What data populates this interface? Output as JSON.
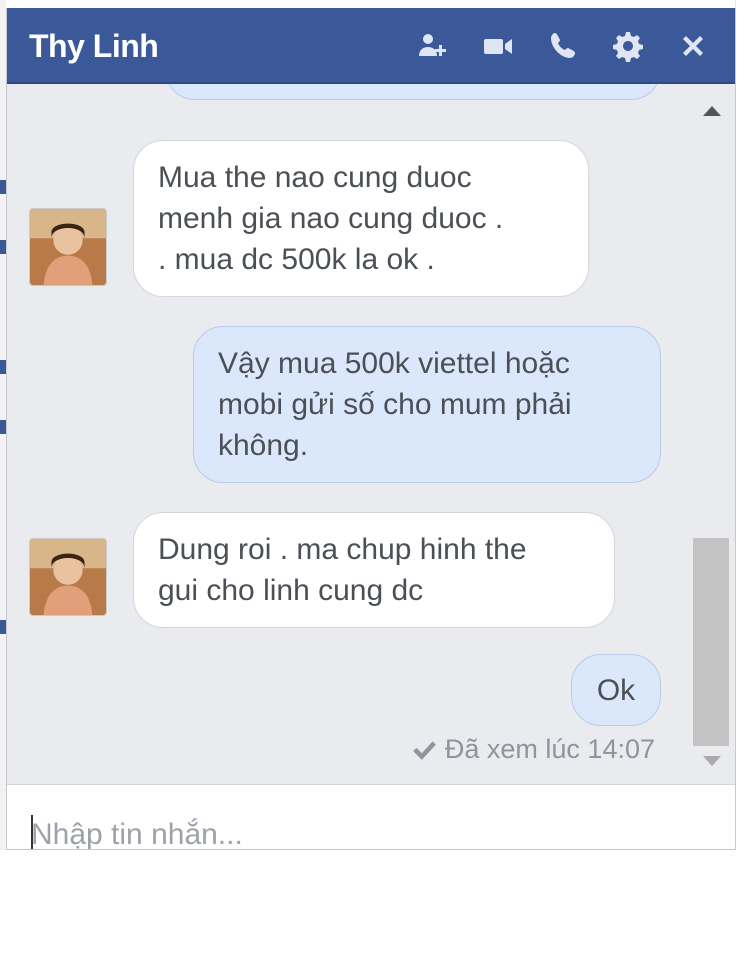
{
  "header": {
    "title": "Thy Linh",
    "icons": [
      "add-people-icon",
      "video-call-icon",
      "phone-icon",
      "gear-icon",
      "close-icon"
    ]
  },
  "messages": [
    {
      "direction": "incoming",
      "lines": [
        "Mua the nao cung duoc",
        "menh gia nao cung duoc .",
        ". mua dc 500k la ok ."
      ]
    },
    {
      "direction": "outgoing",
      "lines": [
        "Vậy mua 500k viettel hoặc",
        "mobi gửi số cho mum phải",
        "không."
      ]
    },
    {
      "direction": "incoming",
      "lines": [
        "Dung roi . ma chup hinh the",
        "gui cho linh cung dc"
      ]
    },
    {
      "direction": "outgoing",
      "lines": [
        "Ok"
      ]
    }
  ],
  "seen_status": "Đã xem lúc  14:07",
  "composer": {
    "placeholder": "Nhập tin nhắn..."
  },
  "colors": {
    "header": "#3b5998",
    "outgoing_bubble": "#dbe8fb",
    "incoming_bubble": "#ffffff",
    "background": "#e9ebee"
  }
}
